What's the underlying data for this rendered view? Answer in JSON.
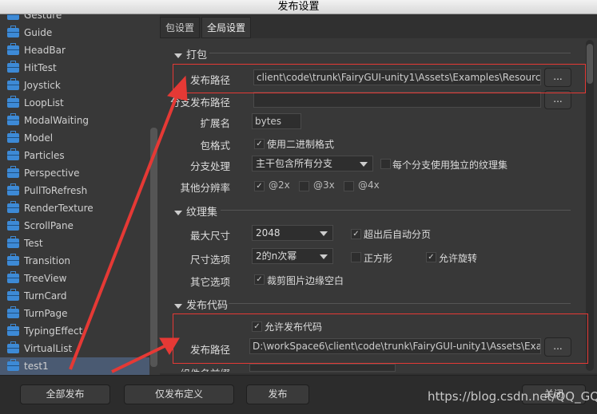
{
  "window": {
    "title": "发布设置"
  },
  "sidebar": {
    "items": [
      "Gesture",
      "Guide",
      "HeadBar",
      "HitTest",
      "Joystick",
      "LoopList",
      "ModalWaiting",
      "Model",
      "Particles",
      "Perspective",
      "PullToRefresh",
      "RenderTexture",
      "ScrollPane",
      "Test",
      "Transition",
      "TreeView",
      "TurnCard",
      "TurnPage",
      "TypingEffect",
      "VirtualList",
      "test1"
    ],
    "selected": "test1",
    "icon": "package-icon"
  },
  "tabs": [
    {
      "label": "包设置",
      "active": false
    },
    {
      "label": "全局设置",
      "active": true
    }
  ],
  "pack": {
    "title": "打包",
    "publish_path_label": "发布路径",
    "publish_path": "client\\code\\trunk\\FairyGUI-unity1\\Assets\\Examples\\Resources\\UI",
    "browse": "...",
    "branch_path_label": "分支发布路径",
    "branch_path": "",
    "ext_label": "扩展名",
    "ext": "bytes",
    "format_label": "包格式",
    "binary_label": "使用二进制格式",
    "binary": true,
    "branch_label": "分支处理",
    "branch_value": "主干包含所有分支",
    "branch_atlas_label": "每个分支使用独立的纹理集",
    "branch_atlas": false,
    "res_label": "其他分辨率",
    "res": [
      {
        "label": "@2x",
        "checked": true
      },
      {
        "label": "@3x",
        "checked": false
      },
      {
        "label": "@4x",
        "checked": false
      }
    ]
  },
  "atlas": {
    "title": "纹理集",
    "max_label": "最大尺寸",
    "max_value": "2048",
    "auto_page_label": "超出后自动分页",
    "auto_page": true,
    "size_label": "尺寸选项",
    "size_value": "2的n次幂",
    "square_label": "正方形",
    "square": false,
    "rotate_label": "允许旋转",
    "rotate": true,
    "other_label": "其它选项",
    "trim_label": "裁剪图片边缘空白",
    "trim": true
  },
  "code": {
    "title": "发布代码",
    "allow_label": "允许发布代码",
    "allow": true,
    "path_label": "发布路径",
    "path": "D:\\workSpace6\\client\\code\\trunk\\FairyGUI-unity1\\Assets\\Example",
    "browse": "...",
    "prefix_label": "组件名前缀"
  },
  "footer": {
    "publish_all": "全部发布",
    "publish_def": "仅发布定义",
    "publish": "发布",
    "close": "关闭"
  },
  "watermark": "https://blog.csdn.net/QQ_GQ",
  "colors": {
    "annotation": "#e53935",
    "accent": "#3d8ad6"
  }
}
